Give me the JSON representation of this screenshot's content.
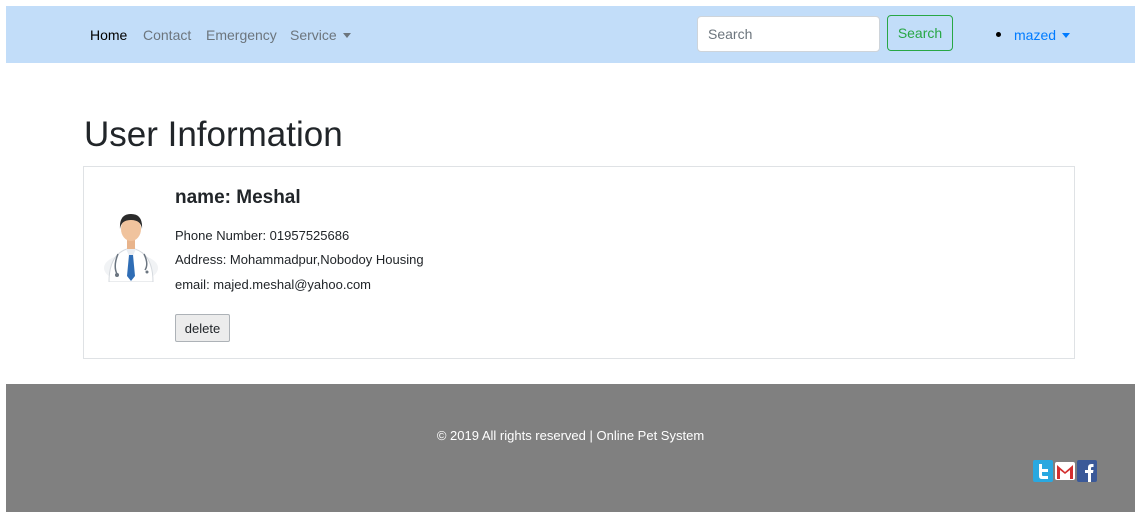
{
  "navbar": {
    "links": [
      {
        "label": "Home"
      },
      {
        "label": "Contact"
      },
      {
        "label": "Emergency"
      },
      {
        "label": "Service"
      }
    ],
    "search_placeholder": "Search",
    "search_button_label": "Search",
    "user_label": "mazed",
    "accent_color": "#c2ddf9"
  },
  "main": {
    "title": "User Information",
    "user": {
      "name": "name: Meshal",
      "phone": "Phone Number: 01957525686",
      "address": "Address: Mohammadpur,Nobodoy Housing",
      "email": "email: majed.meshal@yahoo.com",
      "delete_label": "delete",
      "avatar_icon": "doctor-avatar-icon"
    }
  },
  "footer": {
    "text": "© 2019 All rights reserved | Online Pet System",
    "social_icons": [
      "twitter-icon",
      "gmail-icon",
      "facebook-icon"
    ],
    "background_color": "#808080"
  }
}
